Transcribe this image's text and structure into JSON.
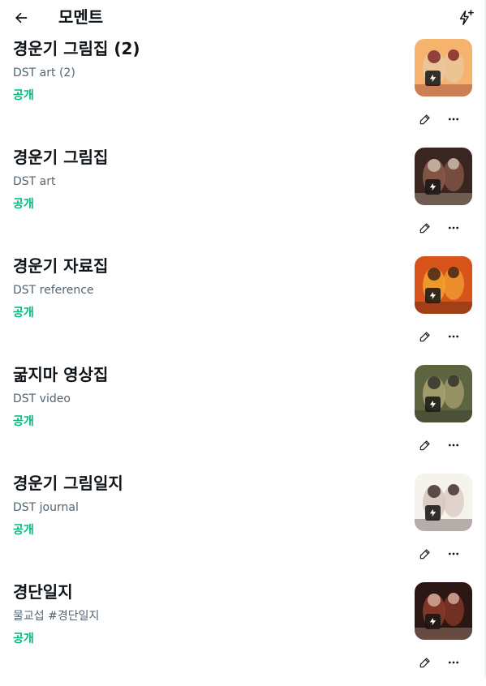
{
  "header": {
    "title": "모멘트",
    "back_icon": "arrow-left-icon",
    "create_icon": "sparkle-lightning-icon"
  },
  "colors": {
    "public_status": "#00ba7c",
    "secondary_text": "#536471"
  },
  "moments": [
    {
      "title": "경운기 그림집 (2)",
      "description": "DST art (2)",
      "status": "공개",
      "thumb_colors": [
        "#f6b36e",
        "#e8c9a0",
        "#7a1f1f"
      ]
    },
    {
      "title": "경운기 그림집",
      "description": "DST art",
      "status": "공개",
      "thumb_colors": [
        "#3a2620",
        "#8a5a4a",
        "#d0c0b0"
      ]
    },
    {
      "title": "경운기 자료집",
      "description": "DST reference",
      "status": "공개",
      "thumb_colors": [
        "#d8541a",
        "#f0a030",
        "#3b1e10"
      ]
    },
    {
      "title": "굶지마 영상집",
      "description": "DST video",
      "status": "공개",
      "thumb_colors": [
        "#5c6440",
        "#a8a070",
        "#2c2c24"
      ]
    },
    {
      "title": "경운기 그림일지",
      "description": "DST journal",
      "status": "공개",
      "thumb_colors": [
        "#f6f3ee",
        "#d8c8c0",
        "#3a2a2a"
      ]
    },
    {
      "title": "경단일지",
      "description": " 물교섭 #경단일지",
      "status": "공개",
      "thumb_colors": [
        "#2a1612",
        "#8a3a2a",
        "#d8b0a0"
      ]
    }
  ],
  "action_icons": {
    "edit": "pencil-icon",
    "more": "more-horizontal-icon",
    "thumb_badge": "lightning-icon"
  }
}
